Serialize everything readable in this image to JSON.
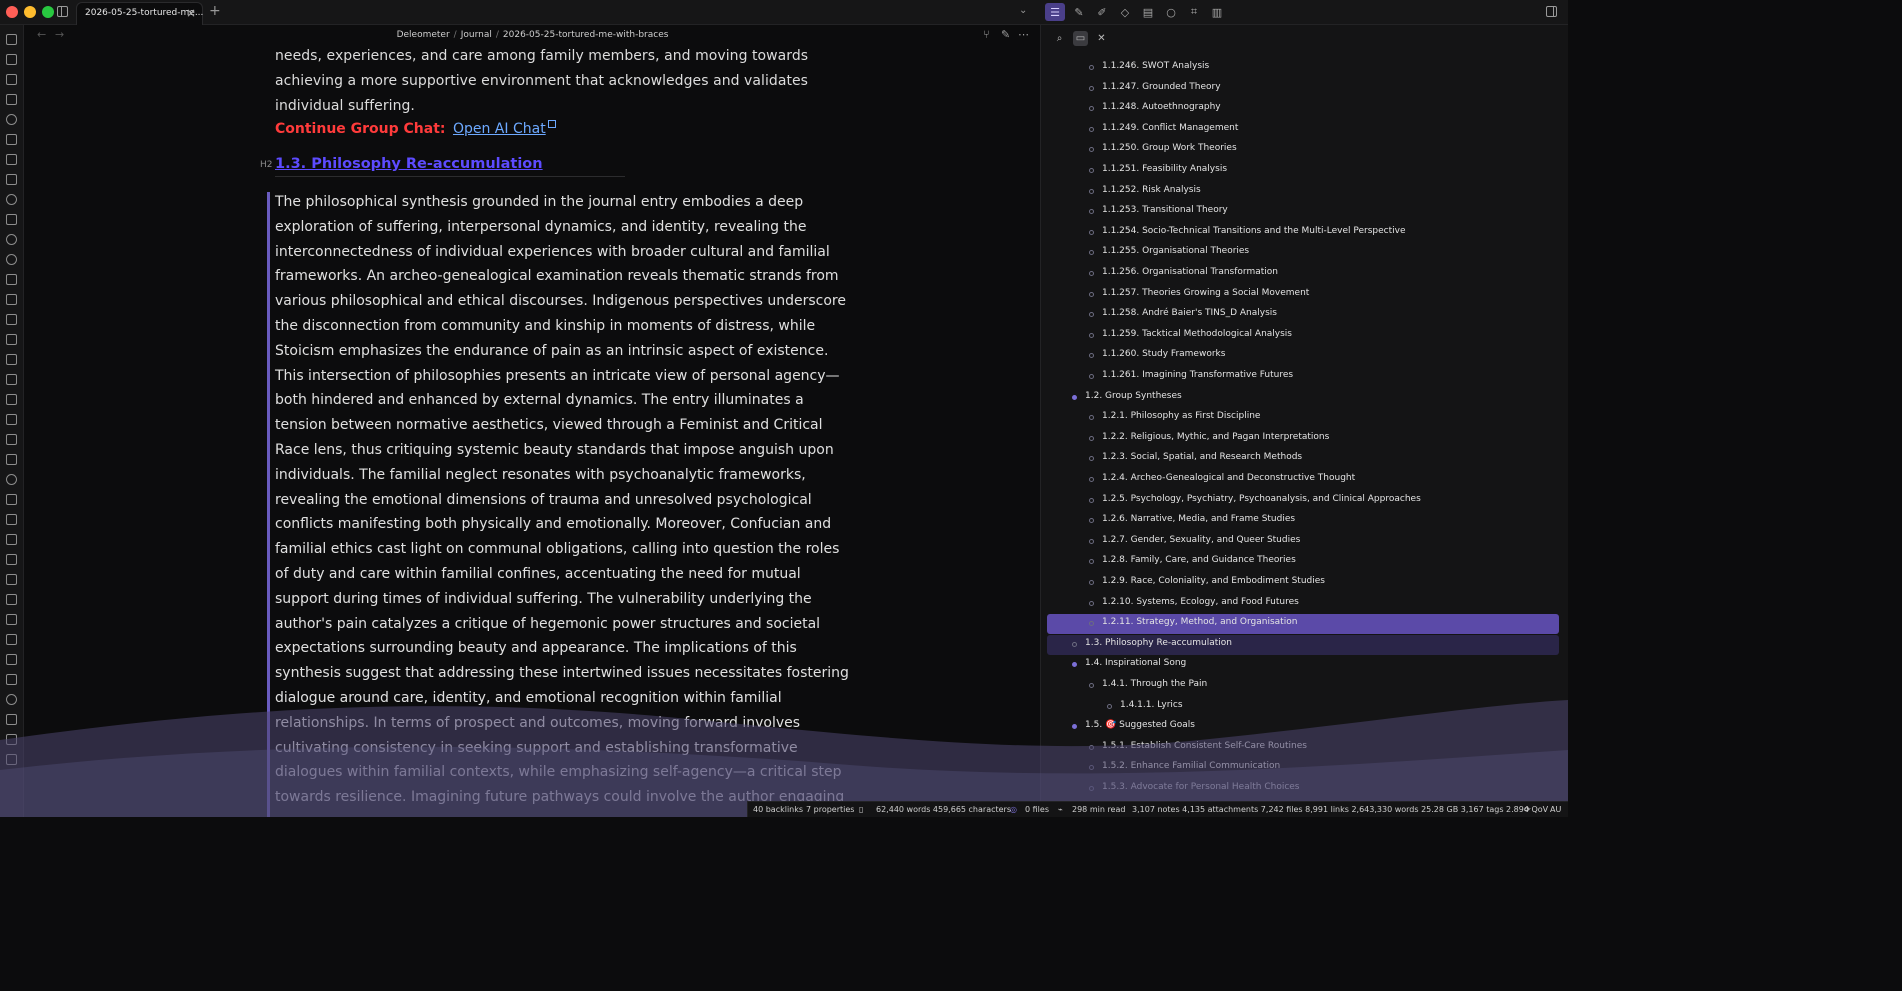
{
  "window": {
    "tab_title": "2026-05-25-tortured-me...",
    "tab_close": "×",
    "new_tab": "+",
    "tab_dropdown": "⌄"
  },
  "breadcrumb": {
    "vault": "Deleometer",
    "folder": "Journal",
    "file": "2026-05-25-tortured-me-with-braces",
    "separator": "/"
  },
  "editor": {
    "intro_lines": [
      "needs, experiences, and care among family members, and moving towards",
      "achieving a more supportive environment that acknowledges and validates",
      "individual suffering."
    ],
    "continue_label": "Continue Group Chat:",
    "continue_link": "Open AI Chat",
    "heading_marker": "H2",
    "heading": "1.3. Philosophy Re-accumulation",
    "callout_lines": [
      "The philosophical synthesis grounded in the journal entry embodies a deep",
      "exploration of suffering, interpersonal dynamics, and identity, revealing the",
      "interconnectedness of individual experiences with broader cultural and familial",
      "frameworks. An archeo-genealogical examination reveals thematic strands from",
      "various philosophical and ethical discourses. Indigenous perspectives underscore",
      "the disconnection from community and kinship in moments of distress, while",
      "Stoicism emphasizes the endurance of pain as an intrinsic aspect of existence.",
      "This intersection of philosophies presents an intricate view of personal agency—",
      "both hindered and enhanced by external dynamics. The entry illuminates a",
      "tension between normative aesthetics, viewed through a Feminist and Critical",
      "Race lens, thus critiquing systemic beauty standards that impose anguish upon",
      "individuals. The familial neglect resonates with psychoanalytic frameworks,",
      "revealing the emotional dimensions of trauma and unresolved psychological",
      "conflicts manifesting both physically and emotionally. Moreover, Confucian and",
      "familial ethics cast light on communal obligations, calling into question the roles",
      "of duty and care within familial confines, accentuating the need for mutual",
      "support during times of individual suffering. The vulnerability underlying the",
      "author's pain catalyzes a critique of hegemonic power structures and societal",
      "expectations surrounding beauty and appearance. The implications of this",
      "synthesis suggest that addressing these intertwined issues necessitates fostering",
      "dialogue around care, identity, and emotional recognition within familial",
      "relationships. In terms of prospect and outcomes, moving forward involves",
      "cultivating consistency in seeking support and establishing transformative",
      "dialogues within familial contexts, while emphasizing self-agency—a critical step",
      "towards resilience. Imagining future pathways could involve the author engaging"
    ]
  },
  "outline": {
    "items": [
      {
        "label": "1.1.246. SWOT Analysis",
        "level": 3
      },
      {
        "label": "1.1.247. Grounded Theory",
        "level": 3
      },
      {
        "label": "1.1.248. Autoethnography",
        "level": 3
      },
      {
        "label": "1.1.249. Conflict Management",
        "level": 3
      },
      {
        "label": "1.1.250. Group Work Theories",
        "level": 3
      },
      {
        "label": "1.1.251. Feasibility Analysis",
        "level": 3
      },
      {
        "label": "1.1.252. Risk Analysis",
        "level": 3
      },
      {
        "label": "1.1.253. Transitional Theory",
        "level": 3
      },
      {
        "label": "1.1.254. Socio-Technical Transitions and the Multi-Level Perspective",
        "level": 3
      },
      {
        "label": "1.1.255. Organisational Theories",
        "level": 3
      },
      {
        "label": "1.1.256. Organisational Transformation",
        "level": 3
      },
      {
        "label": "1.1.257. Theories Growing a Social Movement",
        "level": 3
      },
      {
        "label": "1.1.258. André Baier's TINS_D Analysis",
        "level": 3
      },
      {
        "label": "1.1.259. Tacktical Methodological Analysis",
        "level": 3
      },
      {
        "label": "1.1.260. Study Frameworks",
        "level": 3
      },
      {
        "label": "1.1.261. Imagining Transformative Futures",
        "level": 3
      },
      {
        "label": "1.2. Group Syntheses",
        "level": 2
      },
      {
        "label": "1.2.1. Philosophy as First Discipline",
        "level": 3
      },
      {
        "label": "1.2.2. Religious, Mythic, and Pagan Interpretations",
        "level": 3
      },
      {
        "label": "1.2.3. Social, Spatial, and Research Methods",
        "level": 3
      },
      {
        "label": "1.2.4. Archeo-Genealogical and Deconstructive Thought",
        "level": 3
      },
      {
        "label": "1.2.5. Psychology, Psychiatry, Psychoanalysis, and Clinical Approaches",
        "level": 3
      },
      {
        "label": "1.2.6. Narrative, Media, and Frame Studies",
        "level": 3
      },
      {
        "label": "1.2.7. Gender, Sexuality, and Queer Studies",
        "level": 3
      },
      {
        "label": "1.2.8. Family, Care, and Guidance Theories",
        "level": 3
      },
      {
        "label": "1.2.9. Race, Coloniality, and Embodiment Studies",
        "level": 3
      },
      {
        "label": "1.2.10. Systems, Ecology, and Food Futures",
        "level": 3
      },
      {
        "label": "1.2.11. Strategy, Method, and Organisation",
        "level": 3
      },
      {
        "label": "1.3. Philosophy Re-accumulation",
        "level": 2
      },
      {
        "label": "1.4. Inspirational Song",
        "level": 2
      },
      {
        "label": "1.4.1. Through the Pain",
        "level": 3
      },
      {
        "label": "1.4.1.1. Lyrics",
        "level": 4
      },
      {
        "label": "1.5. 🎯 Suggested Goals",
        "level": 2
      },
      {
        "label": "1.5.1. Establish Consistent Self-Care Routines",
        "level": 3
      },
      {
        "label": "1.5.2. Enhance Familial Communication",
        "level": 3
      },
      {
        "label": "1.5.3. Advocate for Personal Health Choices",
        "level": 3
      }
    ],
    "selected_index": 27,
    "current_index": 28
  },
  "statusbar": {
    "backlinks": "40 backlinks",
    "properties": "7 properties",
    "words_chars": "62,440 words  459,665 characters",
    "files": "0 files",
    "read_time": "298 min read",
    "vault_stats": "3,107 notes 4,135 attachments 7,242 files 8,991 links 2,643,330 words 25.28 GB 3,167 tags 2.894 QoV",
    "lang": "AU"
  },
  "colors": {
    "accent": "#6a5cc0",
    "heading": "#5d4bff",
    "link": "#6da9ff",
    "alert": "#ff3b3b",
    "selected_row": "#5b4aa8",
    "current_row": "#2a2548"
  }
}
